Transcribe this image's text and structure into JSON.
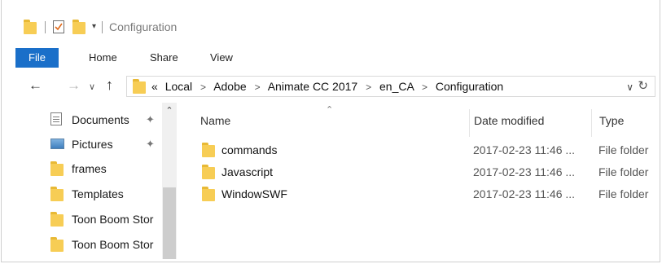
{
  "window": {
    "title": "Configuration"
  },
  "ribbon": {
    "tabs": [
      "File",
      "Home",
      "Share",
      "View"
    ],
    "active_tab": "File",
    "accent_color": "#1a6fc9"
  },
  "address_bar": {
    "overflow_glyph": "«",
    "crumbs": [
      "Local",
      "Adobe",
      "Animate CC 2017",
      "en_CA",
      "Configuration"
    ]
  },
  "nav_pane": {
    "items": [
      {
        "label": "Documents",
        "icon": "documents-icon",
        "pinned": true
      },
      {
        "label": "Pictures",
        "icon": "pictures-icon",
        "pinned": true
      },
      {
        "label": "frames",
        "icon": "folder-icon",
        "pinned": false
      },
      {
        "label": "Templates",
        "icon": "folder-icon",
        "pinned": false
      },
      {
        "label": "Toon Boom Stor",
        "icon": "folder-icon",
        "pinned": false
      },
      {
        "label": "Toon Boom Stor",
        "icon": "folder-icon",
        "pinned": false
      }
    ]
  },
  "file_list": {
    "columns": [
      "Name",
      "Date modified",
      "Type"
    ],
    "sorted_by": "Name",
    "rows": [
      {
        "name": "commands",
        "date": "2017-02-23 11:46 ...",
        "type": "File folder"
      },
      {
        "name": "Javascript",
        "date": "2017-02-23 11:46 ...",
        "type": "File folder"
      },
      {
        "name": "WindowSWF",
        "date": "2017-02-23 11:46 ...",
        "type": "File folder"
      }
    ]
  }
}
